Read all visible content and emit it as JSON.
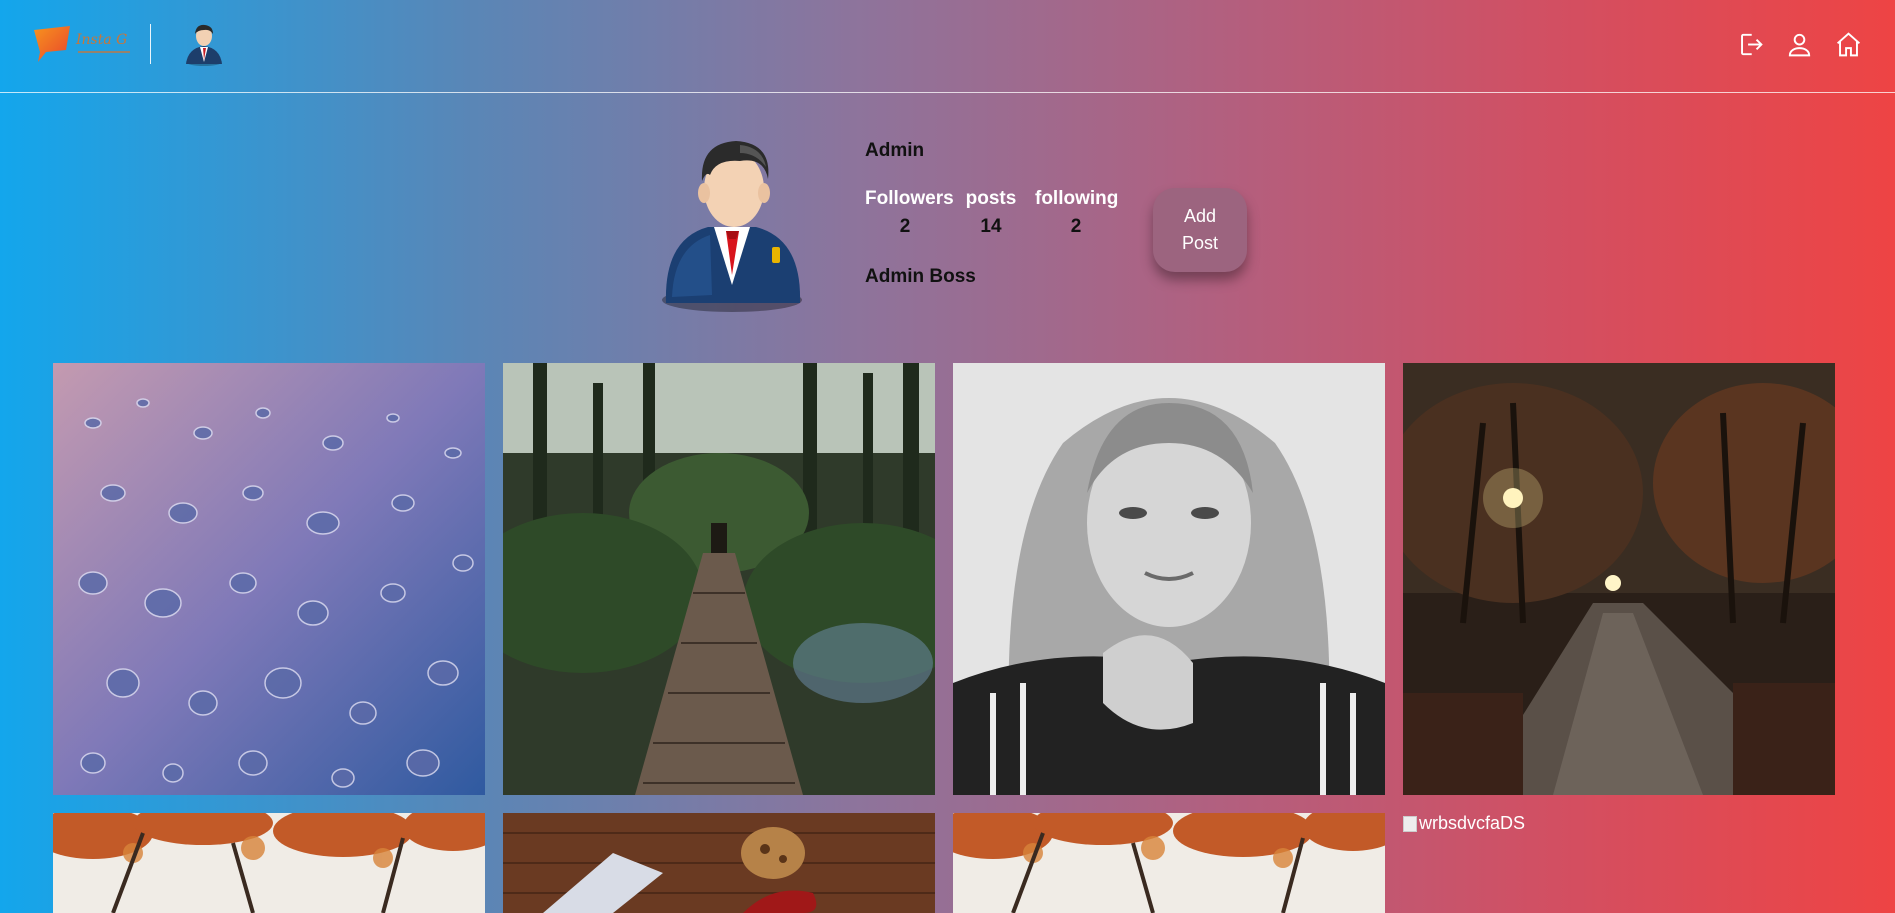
{
  "header": {
    "logo_text": "Insta G",
    "icons": [
      "logout-icon",
      "user-icon",
      "home-icon"
    ]
  },
  "profile": {
    "name": "Admin",
    "stats": [
      {
        "label": "Followers",
        "value": "2"
      },
      {
        "label": "posts",
        "value": "14"
      },
      {
        "label": "following",
        "value": "2"
      }
    ],
    "bio": "Admin Boss",
    "add_post_label_line1": "Add",
    "add_post_label_line2": "Post"
  },
  "posts": {
    "broken_alt": "wrbsdvcfaDS"
  },
  "colors": {
    "gradient_left": "#13a6ec",
    "gradient_right": "#ee4444",
    "add_post_bg": "#9c647f"
  }
}
